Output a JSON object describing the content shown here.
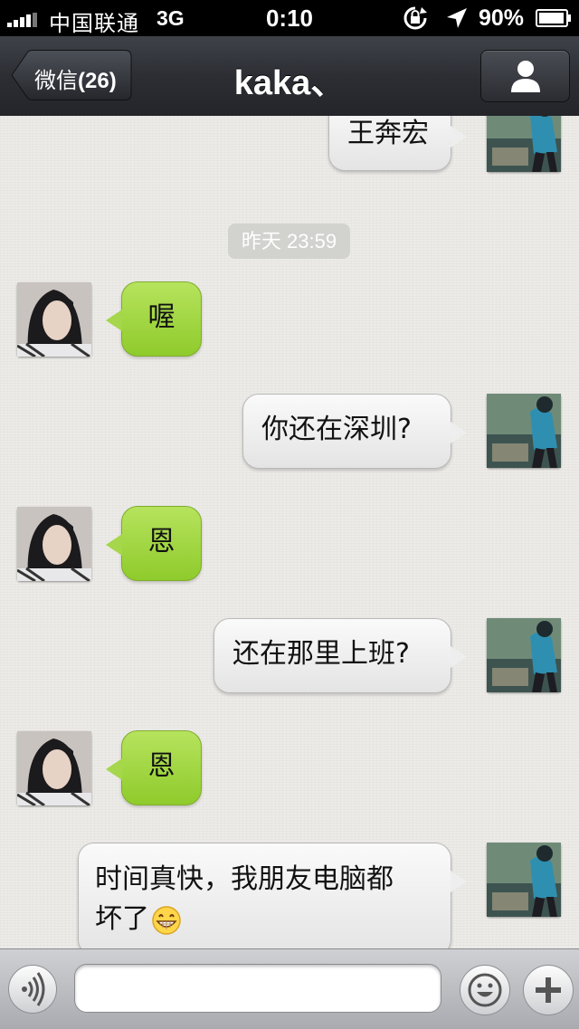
{
  "status_bar": {
    "carrier": "中国联通",
    "network": "3G",
    "time": "0:10",
    "battery": "90%"
  },
  "nav": {
    "back_label": "微信",
    "back_badge": "(26)",
    "title": "kaka、",
    "profile_icon": "person-icon"
  },
  "chat": {
    "timestamp": "昨天 23:59",
    "messages": [
      {
        "from": "me",
        "text": "王奔宏"
      },
      {
        "from": "contact",
        "text": "喔"
      },
      {
        "from": "me",
        "text": "你还在深圳?"
      },
      {
        "from": "contact",
        "text": "恩"
      },
      {
        "from": "me",
        "text": "还在那里上班?"
      },
      {
        "from": "contact",
        "text": "恩"
      },
      {
        "from": "me",
        "text_line1": "时间真快，我朋友电脑都",
        "text_line2": "坏了",
        "emoji": "grin-emoji"
      }
    ]
  },
  "input_bar": {
    "voice_icon": "voice-icon",
    "input_value": "",
    "emoji_icon": "smiley-icon",
    "plus_icon": "plus-icon"
  },
  "colors": {
    "bubble_in": "#9fd23f",
    "bubble_out": "#f2f2f2",
    "nav_bg": "#2c2e34",
    "chat_bg": "#ecebe7"
  }
}
